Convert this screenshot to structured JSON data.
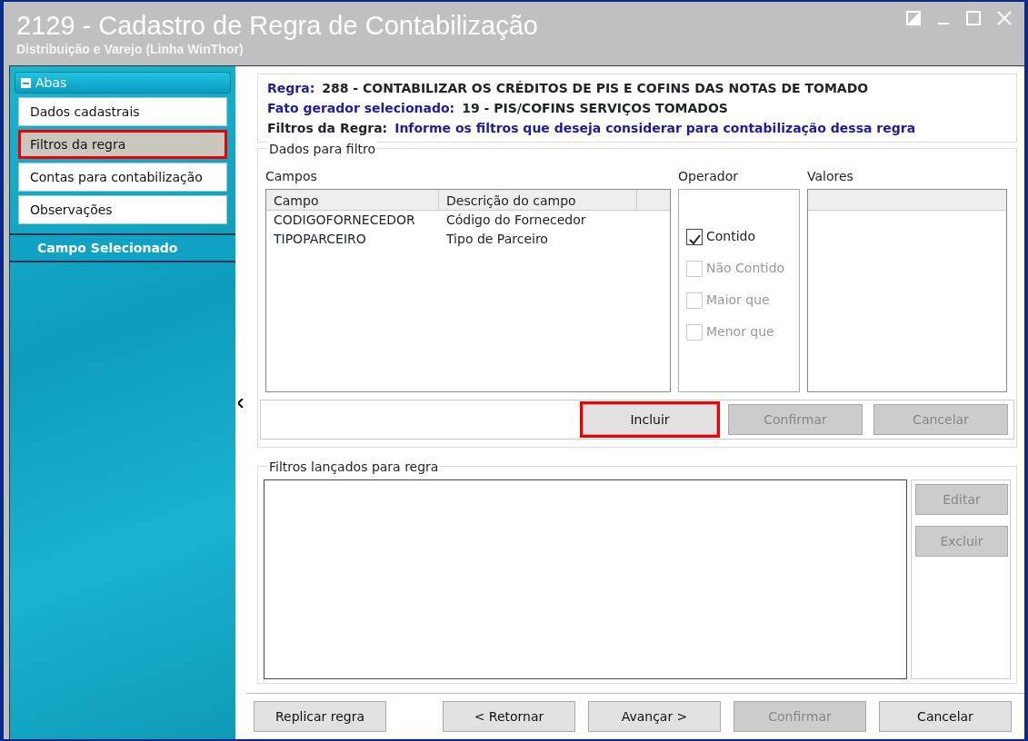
{
  "window": {
    "title": "2129 - Cadastro de Regra de Contabilização",
    "subtitle": "Distribuição e Varejo (Linha WinThor)"
  },
  "sidebar": {
    "header": "Abas",
    "items": [
      {
        "label": "Dados cadastrais",
        "selected": false,
        "highlighted": false
      },
      {
        "label": "Filtros da regra",
        "selected": true,
        "highlighted": true
      },
      {
        "label": "Contas para contabilização",
        "selected": false,
        "highlighted": false
      },
      {
        "label": "Observações",
        "selected": false,
        "highlighted": false
      }
    ],
    "section": "Campo Selecionado"
  },
  "rule_info": [
    {
      "label": "Regra:",
      "value": "288 - CONTABILIZAR OS CRÉDITOS DE PIS E COFINS DAS NOTAS DE TOMADO",
      "kind": "label-blue"
    },
    {
      "label": "Fato gerador selecionado:",
      "value": "19 - PIS/COFINS SERVIÇOS TOMADOS",
      "kind": "label-blue"
    },
    {
      "label": "Filtros da Regra:",
      "value": "Informe os filtros que deseja considerar para contabilização dessa regra",
      "kind": "value-blue"
    }
  ],
  "filter_group": {
    "title": "Dados para filtro",
    "fields_label": "Campos",
    "columns": [
      "Campo",
      "Descrição do campo"
    ],
    "rows": [
      [
        "CODIGOFORNECEDOR",
        "Código do Fornecedor"
      ],
      [
        "TIPOPARCEIRO",
        "Tipo de Parceiro"
      ]
    ],
    "operator_label": "Operador",
    "operators": [
      {
        "label": "Contido",
        "checked": true,
        "disabled": false
      },
      {
        "label": "Não Contido",
        "checked": false,
        "disabled": true
      },
      {
        "label": "Maior que",
        "checked": false,
        "disabled": true
      },
      {
        "label": "Menor que",
        "checked": false,
        "disabled": true
      }
    ],
    "values_label": "Valores",
    "buttons": [
      {
        "label": "Incluir",
        "disabled": false,
        "highlighted": true
      },
      {
        "label": "Confirmar",
        "disabled": true,
        "highlighted": false
      },
      {
        "label": "Cancelar",
        "disabled": true,
        "highlighted": false
      }
    ]
  },
  "launched_group": {
    "title": "Filtros lançados para regra",
    "buttons": [
      {
        "label": "Editar",
        "disabled": true
      },
      {
        "label": "Excluir",
        "disabled": true
      }
    ]
  },
  "footer": [
    {
      "label": "Replicar regra",
      "disabled": false
    },
    {
      "label": "< Retornar",
      "disabled": false
    },
    {
      "label": "Avançar >",
      "disabled": false
    },
    {
      "label": "Confirmar",
      "disabled": true
    },
    {
      "label": "Cancelar",
      "disabled": false
    }
  ]
}
